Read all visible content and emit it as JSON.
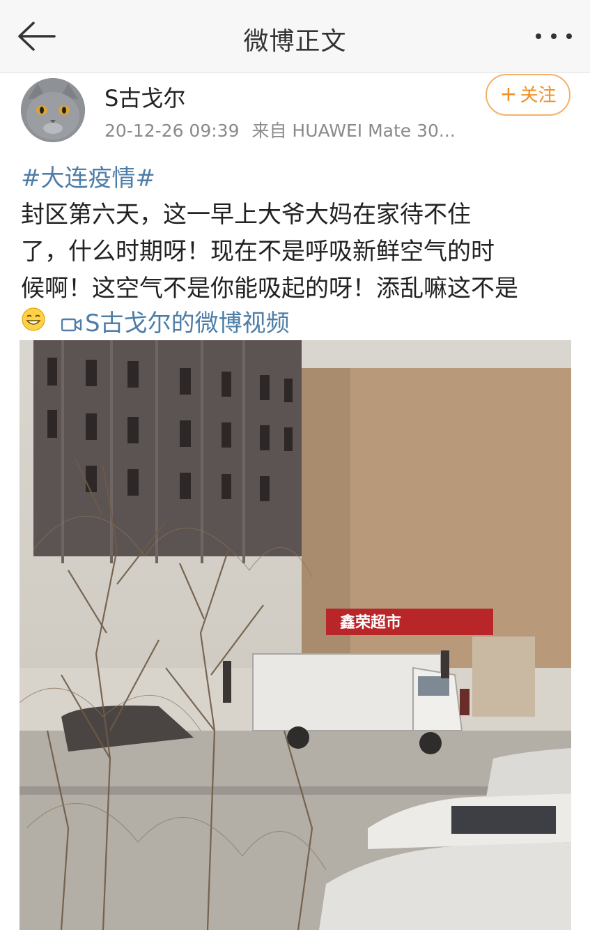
{
  "nav": {
    "title": "微博正文",
    "back_icon": "arrow-left-icon",
    "more_icon": "more-dots-icon"
  },
  "post": {
    "username": "S古戈尔",
    "timestamp": "20-12-26 09:39",
    "source": "来自 HUAWEI Mate 30...",
    "follow_label": "关注",
    "follow_plus": "+",
    "hashtag": "#大连疫情#",
    "lines": [
      "封区第六天，这一早上大爷大妈在家待不住",
      "了，什么时期呀！现在不是呼吸新鲜空气的时",
      "候啊！这空气不是你能吸起的呀！添乱嘛这不是"
    ],
    "emoji_icon": "grinning-emoji-icon",
    "video_link": "S古戈尔的微博视频",
    "photo": {
      "store_sign": "鑫荣超市"
    }
  },
  "colors": {
    "link": "#4e7ea8",
    "follow": "#ef8f25",
    "nav_bg": "#f7f7f7"
  }
}
